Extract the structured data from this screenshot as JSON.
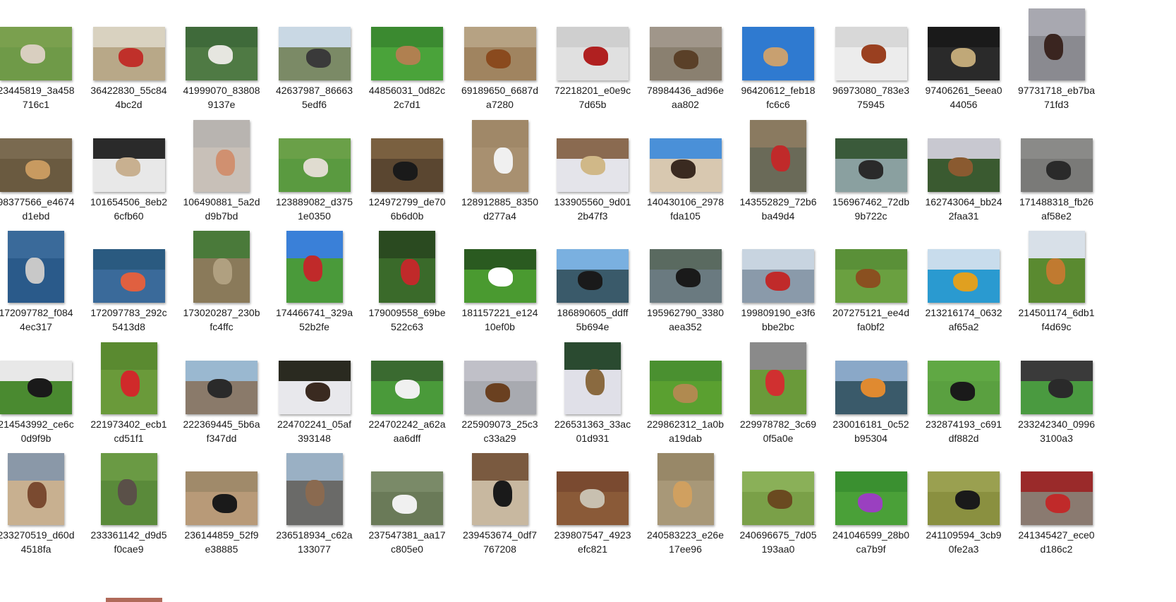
{
  "files": [
    {
      "name": "23445819_3a458716c1",
      "bg": "#6f9a48",
      "fg": "#d9cfc0",
      "sky": "#7aa04e",
      "orient": "land"
    },
    {
      "name": "36422830_55c844bc2d",
      "bg": "#b8a888",
      "fg": "#c0302a",
      "sky": "#d9d2c0",
      "orient": "land"
    },
    {
      "name": "41999070_838089137e",
      "bg": "#4f7a44",
      "fg": "#e6e6e0",
      "sky": "#3f6a3a",
      "orient": "land"
    },
    {
      "name": "42637987_866635edf6",
      "bg": "#7b8a66",
      "fg": "#3a3a3a",
      "sky": "#c9d8e4",
      "orient": "land"
    },
    {
      "name": "44856031_0d82c2c7d1",
      "bg": "#4aa33a",
      "fg": "#b08050",
      "sky": "#3b8a30",
      "orient": "land"
    },
    {
      "name": "69189650_6687da7280",
      "bg": "#a08460",
      "fg": "#8a4a1e",
      "sky": "#b6a283",
      "orient": "land"
    },
    {
      "name": "72218201_e0e9c7d65b",
      "bg": "#e0e0e0",
      "fg": "#b02020",
      "sky": "#cfcfcf",
      "orient": "land"
    },
    {
      "name": "78984436_ad96eaa802",
      "bg": "#8a8070",
      "fg": "#5a4028",
      "sky": "#a0968a",
      "orient": "land"
    },
    {
      "name": "96420612_feb18fc6c6",
      "bg": "#2f7ad0",
      "fg": "#c8a070",
      "sky": "#2f7ad0",
      "orient": "land"
    },
    {
      "name": "96973080_783e375945",
      "bg": "#ececec",
      "fg": "#9a4020",
      "sky": "#d8d8d8",
      "orient": "land"
    },
    {
      "name": "97406261_5eea044056",
      "bg": "#2a2a2a",
      "fg": "#c0a878",
      "sky": "#1a1a1a",
      "orient": "land"
    },
    {
      "name": "97731718_eb7ba71fd3",
      "bg": "#8a8a90",
      "fg": "#3a2520",
      "sky": "#a8a8b0",
      "orient": "tall"
    },
    {
      "name": "98377566_e4674d1ebd",
      "bg": "#6a5a40",
      "fg": "#c89a60",
      "sky": "#7a6a50",
      "orient": "land"
    },
    {
      "name": "101654506_8eb26cfb60",
      "bg": "#e8e8e8",
      "fg": "#c8b090",
      "sky": "#2a2a2a",
      "orient": "land"
    },
    {
      "name": "106490881_5a2dd9b7bd",
      "bg": "#c8c0b8",
      "fg": "#d09070",
      "sky": "#b8b4b0",
      "orient": "tall"
    },
    {
      "name": "123889082_d3751e0350",
      "bg": "#5a9a40",
      "fg": "#e0dcd0",
      "sky": "#6aa048",
      "orient": "land"
    },
    {
      "name": "124972799_de706b6d0b",
      "bg": "#5a4630",
      "fg": "#1a1a1a",
      "sky": "#7a6040",
      "orient": "land"
    },
    {
      "name": "128912885_8350d277a4",
      "bg": "#a89070",
      "fg": "#f0f0f0",
      "sky": "#a08868",
      "orient": "tall"
    },
    {
      "name": "133905560_9d012b47f3",
      "bg": "#e4e4ea",
      "fg": "#d0b888",
      "sky": "#8a6a50",
      "orient": "land"
    },
    {
      "name": "140430106_2978fda105",
      "bg": "#d8c8b0",
      "fg": "#3a2a20",
      "sky": "#4a90d8",
      "orient": "land"
    },
    {
      "name": "143552829_72b6ba49d4",
      "bg": "#6a6a58",
      "fg": "#c02a2a",
      "sky": "#8a7a60",
      "orient": "tall"
    },
    {
      "name": "156967462_72db9b722c",
      "bg": "#8aa0a0",
      "fg": "#2a2a2a",
      "sky": "#3a5a3a",
      "orient": "land"
    },
    {
      "name": "162743064_bb242faa31",
      "bg": "#3a5a30",
      "fg": "#8a5a30",
      "sky": "#c8c8d0",
      "orient": "land"
    },
    {
      "name": "171488318_fb26af58e2",
      "bg": "#7a7a78",
      "fg": "#2a2a2a",
      "sky": "#8a8a88",
      "orient": "land"
    },
    {
      "name": "172097782_f0844ec317",
      "bg": "#2a5a8a",
      "fg": "#c8c8c8",
      "sky": "#3a6a9a",
      "orient": "tall"
    },
    {
      "name": "172097783_292c5413d8",
      "bg": "#3a6a9a",
      "fg": "#e06040",
      "sky": "#2a5a80",
      "orient": "land"
    },
    {
      "name": "173020287_230bfc4ffc",
      "bg": "#8a7a5a",
      "fg": "#b0a080",
      "sky": "#4a7a3a",
      "orient": "tall"
    },
    {
      "name": "174466741_329a52b2fe",
      "bg": "#4a9a3a",
      "fg": "#c02a2a",
      "sky": "#3a80d8",
      "orient": "tall"
    },
    {
      "name": "179009558_69be522c63",
      "bg": "#3a6a2a",
      "fg": "#c02a2a",
      "sky": "#2a4a20",
      "orient": "tall"
    },
    {
      "name": "181157221_e12410ef0b",
      "bg": "#4a9a30",
      "fg": "#ffffff",
      "sky": "#2a5a20",
      "orient": "land"
    },
    {
      "name": "186890605_ddff5b694e",
      "bg": "#3a5a6a",
      "fg": "#1a1a1a",
      "sky": "#7ab0e0",
      "orient": "land"
    },
    {
      "name": "195962790_3380aea352",
      "bg": "#6a7a80",
      "fg": "#1a1a1a",
      "sky": "#5a6a60",
      "orient": "land"
    },
    {
      "name": "199809190_e3f6bbe2bc",
      "bg": "#8a9aaa",
      "fg": "#c02a2a",
      "sky": "#c8d4e0",
      "orient": "land"
    },
    {
      "name": "207275121_ee4dfa0bf2",
      "bg": "#6aa040",
      "fg": "#8a5020",
      "sky": "#5a9038",
      "orient": "land"
    },
    {
      "name": "213216174_0632af65a2",
      "bg": "#2a9ad0",
      "fg": "#e0a020",
      "sky": "#c8dcec",
      "orient": "land"
    },
    {
      "name": "214501174_6db1f4d69c",
      "bg": "#5a8a30",
      "fg": "#c07a30",
      "sky": "#d8e0e8",
      "orient": "tall"
    },
    {
      "name": "214543992_ce6c0d9f9b",
      "bg": "#4a8a30",
      "fg": "#1a1a1a",
      "sky": "#e8e8e8",
      "orient": "land"
    },
    {
      "name": "221973402_ecb1cd51f1",
      "bg": "#6a9a3a",
      "fg": "#d02a2a",
      "sky": "#5a8a30",
      "orient": "tall"
    },
    {
      "name": "222369445_5b6af347dd",
      "bg": "#8a7a6a",
      "fg": "#2a2a2a",
      "sky": "#9ab8d0",
      "orient": "land"
    },
    {
      "name": "224702241_05af393148",
      "bg": "#e8e8ec",
      "fg": "#3a2a20",
      "sky": "#2a2a20",
      "orient": "land"
    },
    {
      "name": "224702242_a62aaa6dff",
      "bg": "#4a9a3a",
      "fg": "#f0f0f0",
      "sky": "#3a6a30",
      "orient": "land"
    },
    {
      "name": "225909073_25c3c33a29",
      "bg": "#a8aab0",
      "fg": "#6a4020",
      "sky": "#c0c0c8",
      "orient": "land"
    },
    {
      "name": "226531363_33ac01d931",
      "bg": "#e0e0e8",
      "fg": "#8a6a40",
      "sky": "#2a4a30",
      "orient": "tall"
    },
    {
      "name": "229862312_1a0ba19dab",
      "bg": "#5aa030",
      "fg": "#b08a50",
      "sky": "#4a9030",
      "orient": "land"
    },
    {
      "name": "229978782_3c690f5a0e",
      "bg": "#6a9a3a",
      "fg": "#d03030",
      "sky": "#8a8a8a",
      "orient": "tall"
    },
    {
      "name": "230016181_0c52b95304",
      "bg": "#3a5a6a",
      "fg": "#e08a30",
      "sky": "#8aa8c8",
      "orient": "land"
    },
    {
      "name": "232874193_c691df882d",
      "bg": "#5aa040",
      "fg": "#1a1a1a",
      "sky": "#60a844",
      "orient": "land"
    },
    {
      "name": "233242340_09963100a3",
      "bg": "#4a9a40",
      "fg": "#2a2a2a",
      "sky": "#3a3a3a",
      "orient": "land"
    },
    {
      "name": "233270519_d60d4518fa",
      "bg": "#c8b090",
      "fg": "#7a4a30",
      "sky": "#8a98a8",
      "orient": "tall"
    },
    {
      "name": "233361142_d9d5f0cae9",
      "bg": "#5a8a3a",
      "fg": "#5a5048",
      "sky": "#6a9a44",
      "orient": "tall"
    },
    {
      "name": "236144859_52f9e38885",
      "bg": "#b89a78",
      "fg": "#1a1a1a",
      "sky": "#a08a6a",
      "orient": "land"
    },
    {
      "name": "236518934_c62a133077",
      "bg": "#6a6a68",
      "fg": "#8a6a50",
      "sky": "#9ab0c4",
      "orient": "tall"
    },
    {
      "name": "237547381_aa17c805e0",
      "bg": "#6a7a58",
      "fg": "#f0f0f0",
      "sky": "#7a8a68",
      "orient": "land"
    },
    {
      "name": "239453674_0df7767208",
      "bg": "#c8b8a0",
      "fg": "#1a1a1a",
      "sky": "#7a5a40",
      "orient": "tall"
    },
    {
      "name": "239807547_4923efc821",
      "bg": "#8a5a38",
      "fg": "#c8c0b0",
      "sky": "#7a4a30",
      "orient": "land"
    },
    {
      "name": "240583223_e26e17ee96",
      "bg": "#a89878",
      "fg": "#d0a060",
      "sky": "#988868",
      "orient": "tall"
    },
    {
      "name": "240696675_7d05193aa0",
      "bg": "#7aa048",
      "fg": "#6a4a20",
      "sky": "#8ab058",
      "orient": "land"
    },
    {
      "name": "241046599_28b0ca7b9f",
      "bg": "#4aa038",
      "fg": "#9a40c0",
      "sky": "#3a9030",
      "orient": "land"
    },
    {
      "name": "241109594_3cb90fe2a3",
      "bg": "#8a9040",
      "fg": "#1a1a1a",
      "sky": "#9aa050",
      "orient": "land"
    },
    {
      "name": "241345427_ece0d186c2",
      "bg": "#8a7a70",
      "fg": "#c02a2a",
      "sky": "#9a2a2a",
      "orient": "land"
    }
  ]
}
